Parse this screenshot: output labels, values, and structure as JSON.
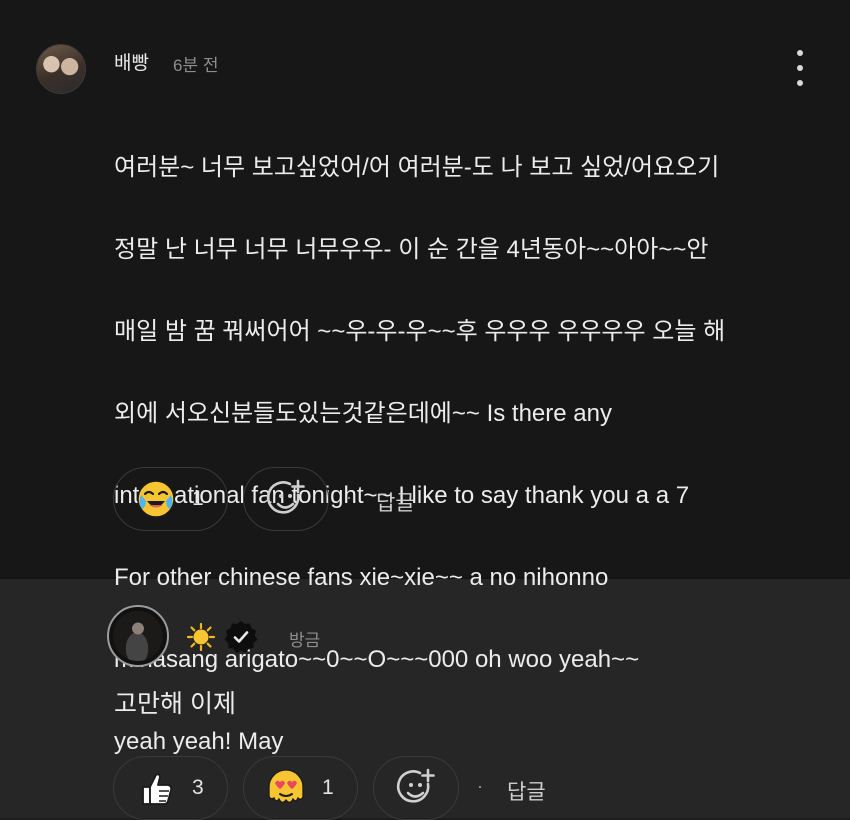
{
  "comment1": {
    "username": "배빵",
    "time": "6분 전",
    "lines": [
      "여러분~ 너무 보고싶었어/어 여러분-도 나 보고 싶었/어요오기",
      "정말 난 너무 너무 너무우우- 이 순 간을 4년동아~~아아~~안",
      "매일 밤 꿈 꿔써어어 ~~우-우-우~~후 우우우 우우우우 오늘 해",
      "외에 서오신분들도있는것같은데에~~ Is there any",
      "international fan tonight~~ I like to say thank you a a 7",
      "For other chinese fans xie~xie~~ a no nihonno",
      "minasang arigato~~0~~O~~~000 oh woo yeah~~",
      "yeah yeah! May"
    ],
    "reactions": [
      {
        "icon": "crying-laughing-emoji-icon",
        "count": "1"
      }
    ],
    "reply_label": "답글",
    "separator": "·"
  },
  "comment2": {
    "username_icons": [
      "sun-emoji-icon",
      "verified-badge-icon"
    ],
    "time": "방금",
    "text": "고만해 이제",
    "reactions": [
      {
        "icon": "thumbs-up-emoji-icon",
        "count": "3"
      },
      {
        "icon": "heart-eyes-melting-emoji-icon",
        "count": "1"
      }
    ],
    "reply_label": "답글",
    "separator": "·"
  },
  "colors": {
    "top_bg": "#171717",
    "bottom_bg": "#262626",
    "text": "#ececec",
    "muted": "#8e8e8e",
    "accent_yellow": "#f7c531"
  }
}
